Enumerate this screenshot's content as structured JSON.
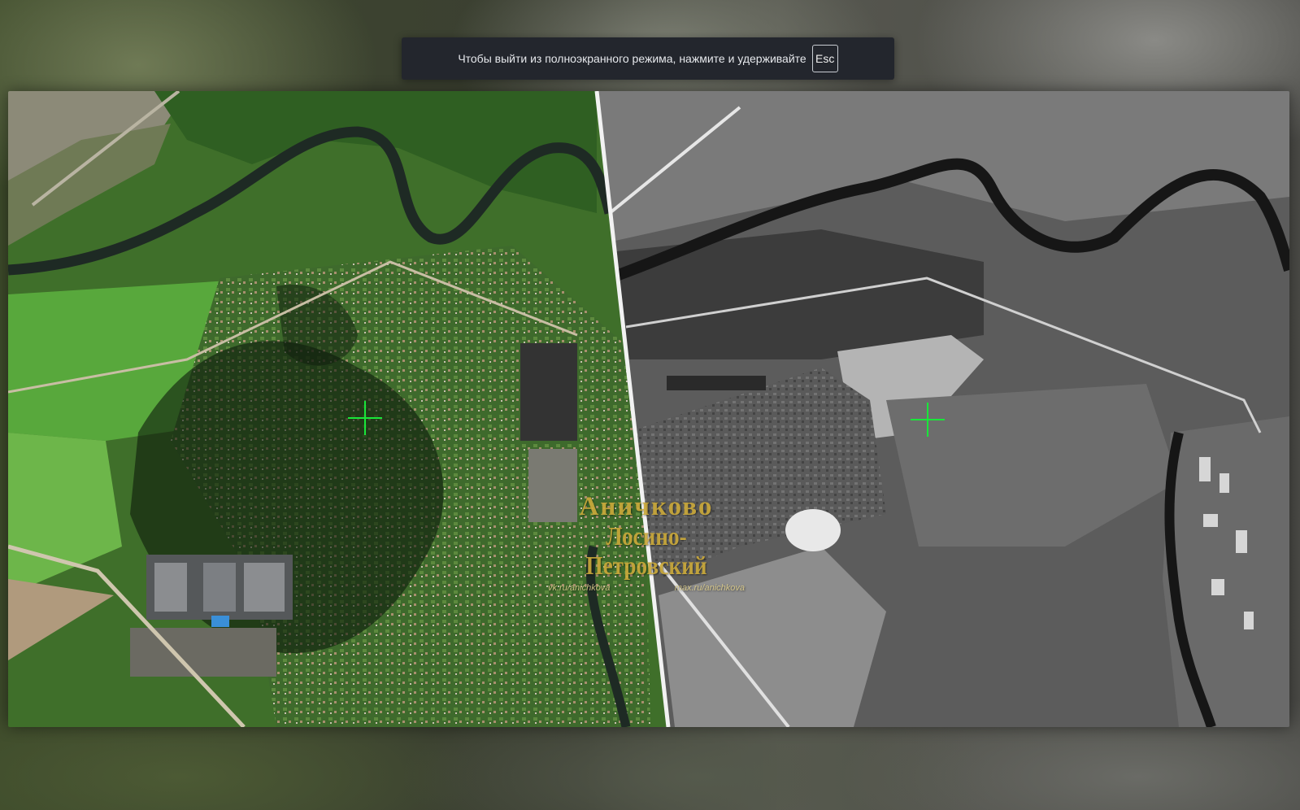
{
  "fullscreen_notice": {
    "message": "Чтобы выйти из полноэкранного режима, нажмите и удерживайте",
    "key": "Esc"
  },
  "image": {
    "modern_panel": "modern-color-satellite-view",
    "historical_panel": "historical-black-white-aerial-view",
    "marker": "crosshair-marker"
  },
  "watermark": {
    "line1": "Аничково",
    "line2": "Лосино-Петровский",
    "link_left": "vk.ru/anichkova",
    "link_right": "max.ru/anichkova"
  },
  "colors": {
    "crosshair": "#19e63a",
    "watermark": "#c9a83a",
    "toast_bg": "#23262d"
  }
}
